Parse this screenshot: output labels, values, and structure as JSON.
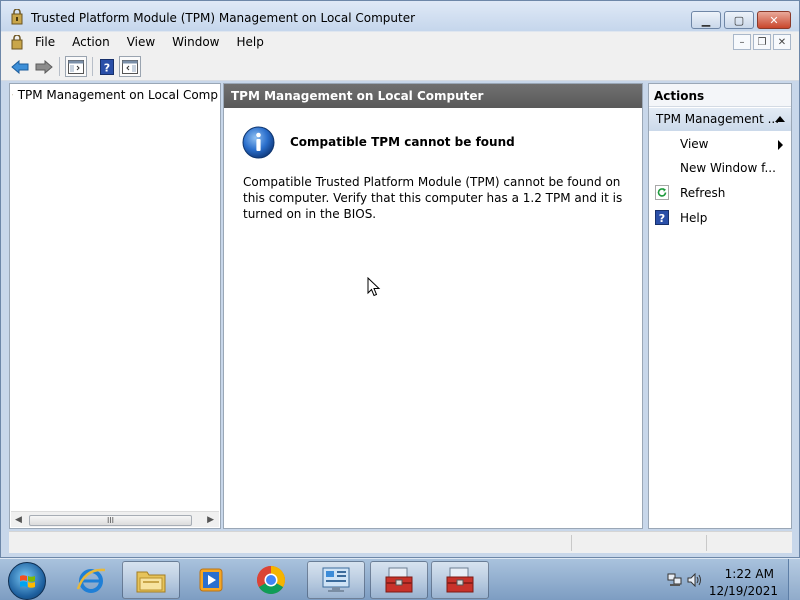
{
  "window": {
    "title": "Trusted Platform Module (TPM) Management on Local Computer",
    "caption_buttons": [
      "minimize",
      "maximize",
      "close"
    ]
  },
  "menu": {
    "items": [
      "File",
      "Action",
      "View",
      "Window",
      "Help"
    ]
  },
  "toolbar": {
    "buttons": [
      "back-arrow-icon",
      "forward-arrow-icon",
      "show-hide-console-tree-icon",
      "help-icon",
      "show-hide-action-pane-icon"
    ]
  },
  "tree": {
    "root_label": "TPM Management on Local Comp",
    "scroll_thumb_glyph": "III"
  },
  "main": {
    "header": "TPM Management on Local Computer",
    "message_title": "Compatible TPM cannot be found",
    "message_body": "Compatible Trusted Platform Module (TPM) cannot be found on this computer. Verify that this computer has a 1.2 TPM and it is turned on in the BIOS."
  },
  "actions": {
    "header": "Actions",
    "group_label": "TPM Management ...",
    "items": [
      {
        "label": "View",
        "icon": "",
        "has_submenu": true
      },
      {
        "label": "New Window f...",
        "icon": "",
        "has_submenu": false
      },
      {
        "label": "Refresh",
        "icon": "refresh-icon",
        "has_submenu": false
      },
      {
        "label": "Help",
        "icon": "help-icon",
        "has_submenu": false
      }
    ]
  },
  "taskbar": {
    "apps": [
      "internet-explorer-icon",
      "file-explorer-icon",
      "media-player-icon",
      "chrome-icon",
      "control-panel-icon",
      "toolbox-icon",
      "toolbox-icon"
    ],
    "active_apps": [
      6
    ]
  },
  "clock": {
    "time": "1:22 AM",
    "date": "12/19/2021"
  },
  "colors": {
    "header_gray": "#5f5f5f",
    "info_blue": "#1f5fb4",
    "taskbar": "#8eabcd"
  }
}
